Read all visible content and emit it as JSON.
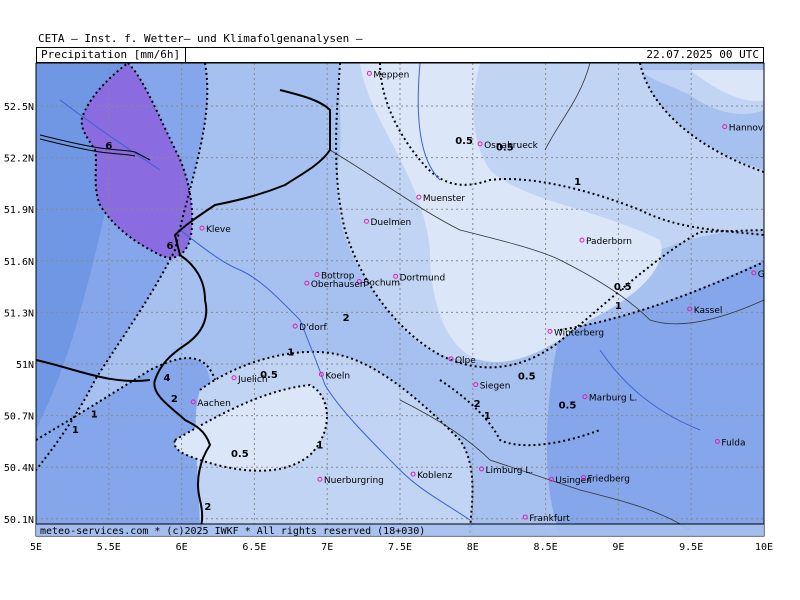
{
  "header": {
    "title": "CETA — Inst. f. Wetter— und Klimafolgenanalysen —",
    "variable": "Precipitation [mm/6h]",
    "valid_time": "22.07.2025 00 UTC"
  },
  "footer": {
    "credit": "meteo-services.com * (c)2025 IWKF * All rights reserved (18+030)"
  },
  "axes": {
    "lon_labels": [
      "5E",
      "5.5E",
      "6E",
      "6.5E",
      "7E",
      "7.5E",
      "8E",
      "8.5E",
      "9E",
      "9.5E",
      "10E"
    ],
    "lat_labels": [
      "52.5N",
      "52.2N",
      "51.9N",
      "51.6N",
      "51.3N",
      "51N",
      "50.7N",
      "50.4N",
      "50.1N"
    ]
  },
  "colors": {
    "lightest": "#dbe6f8",
    "light": "#c2d4f4",
    "mid": "#a6c0ef",
    "dark": "#85a6ea",
    "darker": "#6690e2",
    "purple": "#8a6be0"
  },
  "cities": [
    {
      "name": "Meppen",
      "lon": 7.29,
      "lat": 52.69
    },
    {
      "name": "Osnabrueck",
      "lon": 8.05,
      "lat": 52.28
    },
    {
      "name": "Hannover",
      "lon": 9.73,
      "lat": 52.38
    },
    {
      "name": "Muenster",
      "lon": 7.63,
      "lat": 51.97
    },
    {
      "name": "Kleve",
      "lon": 6.14,
      "lat": 51.79
    },
    {
      "name": "Duelmen",
      "lon": 7.27,
      "lat": 51.83
    },
    {
      "name": "Paderborn",
      "lon": 8.75,
      "lat": 51.72
    },
    {
      "name": "Goettingen",
      "lon": 9.93,
      "lat": 51.53
    },
    {
      "name": "Bottrop",
      "lon": 6.93,
      "lat": 51.52
    },
    {
      "name": "Bochum",
      "lon": 7.22,
      "lat": 51.48
    },
    {
      "name": "Dortmund",
      "lon": 7.47,
      "lat": 51.51
    },
    {
      "name": "Oberhausen",
      "lon": 6.86,
      "lat": 51.47
    },
    {
      "name": "Kassel",
      "lon": 9.49,
      "lat": 51.32
    },
    {
      "name": "D'dorf",
      "lon": 6.78,
      "lat": 51.22
    },
    {
      "name": "Winterberg",
      "lon": 8.53,
      "lat": 51.19
    },
    {
      "name": "Olpe",
      "lon": 7.85,
      "lat": 51.03
    },
    {
      "name": "Juelich",
      "lon": 6.36,
      "lat": 50.92
    },
    {
      "name": "Koeln",
      "lon": 6.96,
      "lat": 50.94
    },
    {
      "name": "Siegen",
      "lon": 8.02,
      "lat": 50.88
    },
    {
      "name": "Aachen",
      "lon": 6.08,
      "lat": 50.78
    },
    {
      "name": "Marburg L.",
      "lon": 8.77,
      "lat": 50.81
    },
    {
      "name": "Fulda",
      "lon": 9.68,
      "lat": 50.55
    },
    {
      "name": "Koblenz",
      "lon": 7.59,
      "lat": 50.36
    },
    {
      "name": "Limburg L.",
      "lon": 8.06,
      "lat": 50.39
    },
    {
      "name": "Usingen",
      "lon": 8.54,
      "lat": 50.33
    },
    {
      "name": "Friedberg",
      "lon": 8.76,
      "lat": 50.34
    },
    {
      "name": "Nuerburgring",
      "lon": 6.95,
      "lat": 50.33
    },
    {
      "name": "Frankfurt",
      "lon": 8.36,
      "lat": 50.11
    }
  ],
  "contour_labels": [
    {
      "text": "0.5",
      "lon": 8.22,
      "lat": 52.24
    },
    {
      "text": "0.5",
      "lon": 7.94,
      "lat": 52.28
    },
    {
      "text": "1",
      "lon": 8.72,
      "lat": 52.04
    },
    {
      "text": "6",
      "lon": 5.5,
      "lat": 52.25
    },
    {
      "text": "6",
      "lon": 5.92,
      "lat": 51.67
    },
    {
      "text": "0.5",
      "lon": 9.03,
      "lat": 51.43
    },
    {
      "text": "1",
      "lon": 9.0,
      "lat": 51.32
    },
    {
      "text": "2",
      "lon": 7.13,
      "lat": 51.25
    },
    {
      "text": "1",
      "lon": 6.75,
      "lat": 51.05
    },
    {
      "text": "0.5",
      "lon": 6.6,
      "lat": 50.92
    },
    {
      "text": "4",
      "lon": 5.9,
      "lat": 50.9
    },
    {
      "text": "2",
      "lon": 5.95,
      "lat": 50.78
    },
    {
      "text": "1",
      "lon": 5.4,
      "lat": 50.69
    },
    {
      "text": "1",
      "lon": 5.27,
      "lat": 50.6
    },
    {
      "text": "1",
      "lon": 6.95,
      "lat": 50.51
    },
    {
      "text": "0.5",
      "lon": 6.4,
      "lat": 50.46
    },
    {
      "text": "0.5",
      "lon": 8.37,
      "lat": 50.91
    },
    {
      "text": "2",
      "lon": 8.03,
      "lat": 50.75
    },
    {
      "text": "1",
      "lon": 8.1,
      "lat": 50.68
    },
    {
      "text": "0.5",
      "lon": 8.65,
      "lat": 50.74
    },
    {
      "text": "2",
      "lon": 6.18,
      "lat": 50.15
    }
  ]
}
